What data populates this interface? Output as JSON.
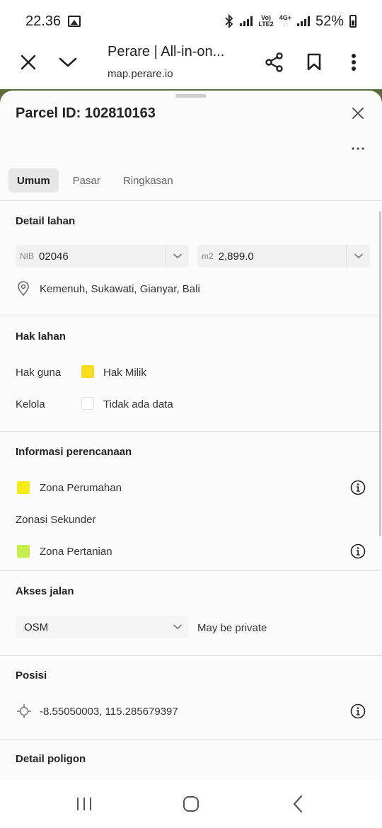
{
  "status_bar": {
    "time": "22.36",
    "network_top": "Vo)",
    "network_bottom": "LTE2",
    "network2_top": "4G+",
    "network2_bottom": "↓↑",
    "battery": "52%"
  },
  "browser": {
    "title": "Perare | All-in-on...",
    "url": "map.perare.io"
  },
  "sheet": {
    "title": "Parcel ID: 102810163",
    "tabs": [
      {
        "label": "Umum",
        "active": true
      },
      {
        "label": "Pasar",
        "active": false
      },
      {
        "label": "Ringkasan",
        "active": false
      }
    ],
    "detail_lahan": {
      "title": "Detail lahan",
      "nib_prefix": "NIB",
      "nib_value": "02046",
      "area_prefix": "m2",
      "area_value": "2,899.0",
      "location": "Kemenuh, Sukawati, Gianyar, Bali"
    },
    "hak_lahan": {
      "title": "Hak lahan",
      "hak_guna_label": "Hak guna",
      "hak_guna_value": "Hak Milik",
      "hak_guna_color": "#f7dc1f",
      "kelola_label": "Kelola",
      "kelola_value": "Tidak ada data"
    },
    "perencanaan": {
      "title": "Informasi perencanaan",
      "zona_utama": "Zona Perumahan",
      "zona_utama_color": "#f7e81a",
      "sekunder_label": "Zonasi Sekunder",
      "zona_sekunder": "Zona Pertanian",
      "zona_sekunder_color": "#c6ee4a"
    },
    "akses_jalan": {
      "title": "Akses jalan",
      "source": "OSM",
      "note": "May be private"
    },
    "posisi": {
      "title": "Posisi",
      "coordinates": "-8.55050003, 115.285679397"
    },
    "detail_poligon": {
      "title": "Detail poligon"
    }
  }
}
